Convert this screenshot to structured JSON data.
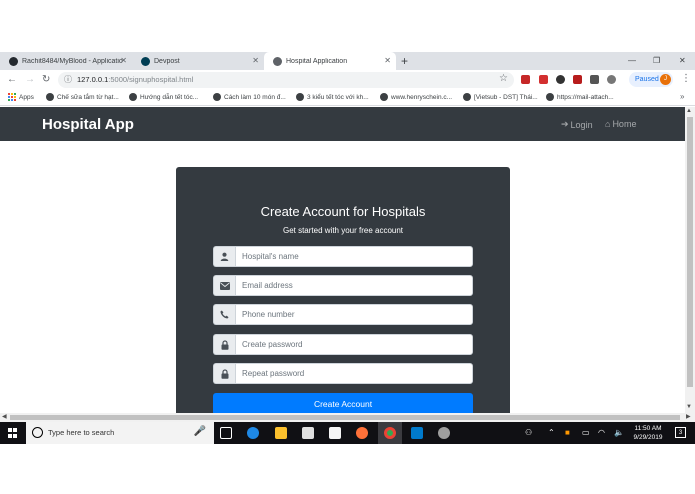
{
  "browser": {
    "tabs": [
      {
        "title": "Rachit8484/MyBlood - Applicatio",
        "icon": "github-icon"
      },
      {
        "title": "Devpost",
        "icon": "devpost-icon"
      },
      {
        "title": "Hospital Application",
        "icon": "globe-icon"
      }
    ],
    "url_host": "127.0.0.1",
    "url_path": ":5000/signuphospital.html",
    "profile_status": "Paused",
    "profile_initial": "J",
    "bookmarks": [
      "Apps",
      "Chế sữa tắm từ hạt...",
      "Hướng dẫn tết tóc...",
      "Cách làm 10 món đ...",
      "3 kiểu tết tóc với kh...",
      "www.henryschein.c...",
      "[Vietsub - DST] Thái...",
      "https://mail-attach..."
    ]
  },
  "page": {
    "brand": "Hospital App",
    "nav": {
      "login": "Login",
      "home": "Home"
    },
    "form": {
      "title": "Create Account for Hospitals",
      "subtitle": "Get started with your free account",
      "fields": [
        {
          "placeholder": "Hospital's name",
          "icon": "user-icon"
        },
        {
          "placeholder": "Email address",
          "icon": "envelope-icon"
        },
        {
          "placeholder": "Phone number",
          "icon": "phone-icon"
        },
        {
          "placeholder": "Create password",
          "icon": "lock-icon"
        },
        {
          "placeholder": "Repeat password",
          "icon": "lock-icon"
        }
      ],
      "submit_label": "Create Account"
    }
  },
  "taskbar": {
    "search_placeholder": "Type here to search",
    "time": "11:50 AM",
    "date": "9/29/2019",
    "notifications": "3"
  },
  "colors": {
    "navbar": "#343a40",
    "primary": "#007bff",
    "card": "#343a40"
  }
}
